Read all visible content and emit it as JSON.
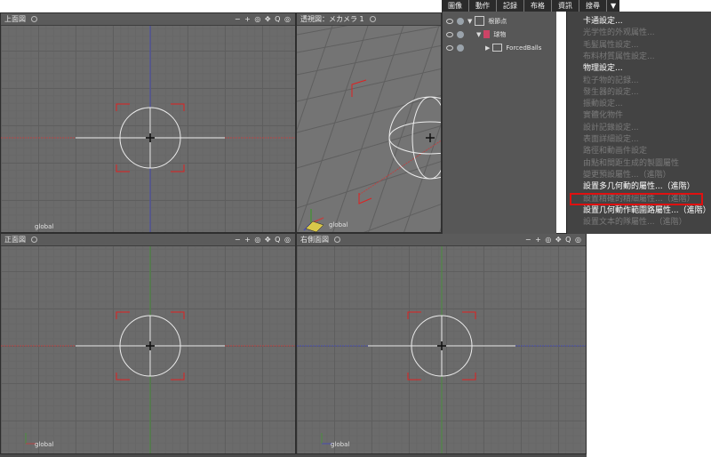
{
  "viewports": {
    "top": {
      "title": "上面図",
      "tools": "− + ◎ ✥ Q ◎",
      "label": "global",
      "axis": "y"
    },
    "persp": {
      "title": "透視図：メカメラ 1",
      "tools": "",
      "label": "global",
      "axis": "y"
    },
    "front": {
      "title": "正面図",
      "tools": "− + ◎ ✥ Q ◎",
      "label": "global",
      "axis": "y"
    },
    "right": {
      "title": "右側面図",
      "tools": "− + ◎ ✥ Q ◎",
      "label": "global",
      "axis": "y"
    }
  },
  "tabs": [
    "圖像",
    "動作",
    "記録",
    "布格",
    "資訊",
    "搜尋"
  ],
  "tab_arrow": "▼",
  "outliner": {
    "items": [
      {
        "label": "根節点"
      },
      {
        "label": "球物"
      },
      {
        "label": "ForcedBalls"
      }
    ]
  },
  "menu": {
    "items": [
      {
        "label": "卡通設定...",
        "enabled": true
      },
      {
        "label": "光学性的外观属性...",
        "enabled": false
      },
      {
        "label": "毛髪属性設定...",
        "enabled": false
      },
      {
        "label": "布料材質属性設定...",
        "enabled": false
      },
      {
        "label": "物理設定...",
        "enabled": true
      },
      {
        "label": "粒子物的記録...",
        "enabled": false
      },
      {
        "label": "發生器的設定...",
        "enabled": false
      },
      {
        "label": "振動設定...",
        "enabled": false
      },
      {
        "label": "實體化物件",
        "enabled": false
      },
      {
        "label": "設計記錄設定...",
        "enabled": false
      },
      {
        "label": "表面詳細設定...",
        "enabled": false
      },
      {
        "label": "路徑和動画件設定",
        "enabled": false
      },
      {
        "label": "由點和間距生成的製圖屬性",
        "enabled": false
      },
      {
        "label": "變更預設屬性...（進階）",
        "enabled": false
      },
      {
        "label": "設置多几何動的屬性...（進階）",
        "enabled": true
      },
      {
        "label": "設置精確的精細屬性...（進階）",
        "enabled": false
      },
      {
        "label": "設置几何動作範圍路屬性...（進階）",
        "enabled": true
      },
      {
        "label": "設置文本的隊屬性...（進階）",
        "enabled": false
      }
    ],
    "highlighted_index": 14,
    "highlight_color": "#e01010"
  },
  "colors": {
    "x_axis": "#b84545",
    "y_axis": "#4a8f3c",
    "z_axis": "#4a4fb0",
    "camera_frame": "#e02020",
    "wire": "#ededed"
  }
}
